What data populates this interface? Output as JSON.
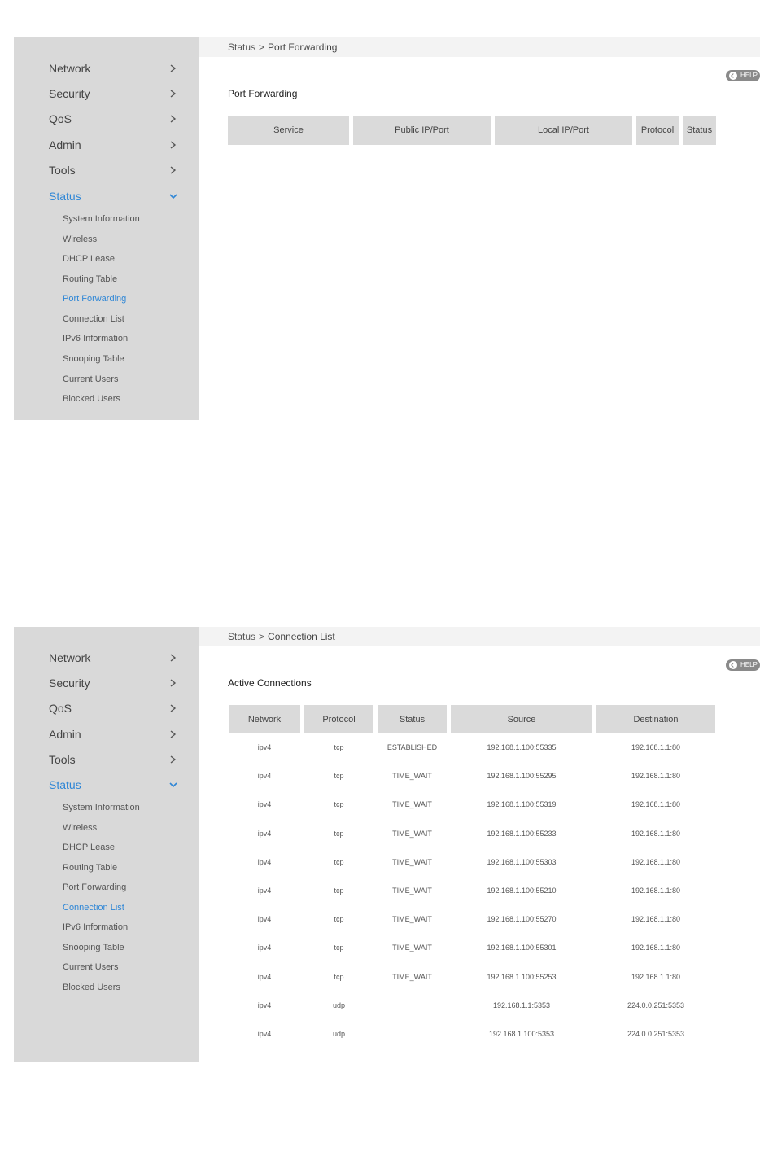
{
  "nav": {
    "items": [
      {
        "label": "Network"
      },
      {
        "label": "Security"
      },
      {
        "label": "QoS"
      },
      {
        "label": "Admin"
      },
      {
        "label": "Tools"
      },
      {
        "label": "Status"
      }
    ],
    "sub_items": [
      {
        "label": "System Information"
      },
      {
        "label": "Wireless"
      },
      {
        "label": "DHCP Lease"
      },
      {
        "label": "Routing Table"
      },
      {
        "label": "Port Forwarding"
      },
      {
        "label": "Connection List"
      },
      {
        "label": "IPv6 Information"
      },
      {
        "label": "Snooping Table"
      },
      {
        "label": "Current Users"
      },
      {
        "label": "Blocked Users"
      }
    ]
  },
  "help_label": "HELP",
  "port_forwarding_panel": {
    "breadcrumb": {
      "root": "Status",
      "separator": ">",
      "current": "Port Forwarding"
    },
    "title": "Port Forwarding",
    "columns": [
      "Service",
      "Public IP/Port",
      "Local IP/Port",
      "Protocol",
      "Status"
    ]
  },
  "connection_list_panel": {
    "breadcrumb": {
      "root": "Status",
      "separator": ">",
      "current": "Connection List"
    },
    "title": "Active Connections",
    "columns": [
      "Network",
      "Protocol",
      "Status",
      "Source",
      "Destination"
    ],
    "rows": [
      [
        "ipv4",
        "tcp",
        "ESTABLISHED",
        "192.168.1.100:55335",
        "192.168.1.1:80"
      ],
      [
        "ipv4",
        "tcp",
        "TIME_WAIT",
        "192.168.1.100:55295",
        "192.168.1.1:80"
      ],
      [
        "ipv4",
        "tcp",
        "TIME_WAIT",
        "192.168.1.100:55319",
        "192.168.1.1:80"
      ],
      [
        "ipv4",
        "tcp",
        "TIME_WAIT",
        "192.168.1.100:55233",
        "192.168.1.1:80"
      ],
      [
        "ipv4",
        "tcp",
        "TIME_WAIT",
        "192.168.1.100:55303",
        "192.168.1.1:80"
      ],
      [
        "ipv4",
        "tcp",
        "TIME_WAIT",
        "192.168.1.100:55210",
        "192.168.1.1:80"
      ],
      [
        "ipv4",
        "tcp",
        "TIME_WAIT",
        "192.168.1.100:55270",
        "192.168.1.1:80"
      ],
      [
        "ipv4",
        "tcp",
        "TIME_WAIT",
        "192.168.1.100:55301",
        "192.168.1.1:80"
      ],
      [
        "ipv4",
        "tcp",
        "TIME_WAIT",
        "192.168.1.100:55253",
        "192.168.1.1:80"
      ],
      [
        "ipv4",
        "udp",
        "",
        "192.168.1.1:5353",
        "224.0.0.251:5353"
      ],
      [
        "ipv4",
        "udp",
        "",
        "192.168.1.100:5353",
        "224.0.0.251:5353"
      ]
    ]
  },
  "colors": {
    "sidebar_bg": "#d9d9d9",
    "active": "#2e86d6",
    "header_cell": "#dadada",
    "help_bg": "#8a8a8a"
  }
}
